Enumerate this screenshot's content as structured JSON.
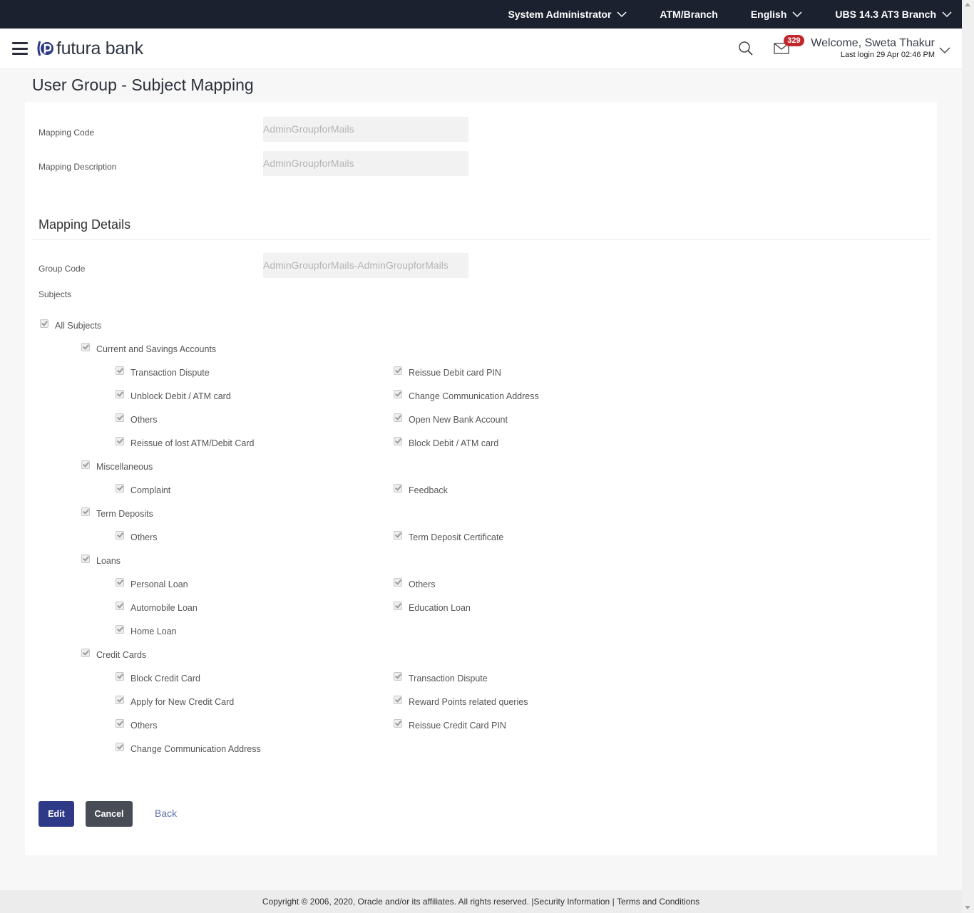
{
  "topbar": {
    "role": "System Administrator",
    "location": "ATM/Branch",
    "language": "English",
    "branch": "UBS 14.3 AT3 Branch"
  },
  "header": {
    "brand": "futura bank",
    "mail_count": "329",
    "welcome": "Welcome, Sweta Thakur",
    "last_login": "Last login 29 Apr 02:46 PM"
  },
  "page_title": "User Group - Subject Mapping",
  "form": {
    "mapping_code_label": "Mapping Code",
    "mapping_code_value": "AdminGroupforMails",
    "mapping_description_label": "Mapping Description",
    "mapping_description_value": "AdminGroupforMails",
    "section_title": "Mapping Details",
    "group_code_label": "Group Code",
    "group_code_value": "AdminGroupforMails-AdminGroupforMails",
    "subjects_label": "Subjects"
  },
  "subjects": {
    "all": {
      "label": "All Subjects",
      "checked": true
    },
    "categories": [
      {
        "label": "Current and Savings Accounts",
        "checked": true,
        "items": [
          {
            "label": "Transaction Dispute",
            "checked": true
          },
          {
            "label": "Reissue Debit card PIN",
            "checked": true
          },
          {
            "label": "Unblock Debit / ATM card",
            "checked": true
          },
          {
            "label": "Change Communication Address",
            "checked": true
          },
          {
            "label": "Others",
            "checked": true
          },
          {
            "label": "Open New Bank Account",
            "checked": true
          },
          {
            "label": "Reissue of lost ATM/Debit Card",
            "checked": true
          },
          {
            "label": "Block Debit / ATM card",
            "checked": true
          }
        ]
      },
      {
        "label": "Miscellaneous",
        "checked": true,
        "items": [
          {
            "label": "Complaint",
            "checked": true
          },
          {
            "label": "Feedback",
            "checked": true
          }
        ]
      },
      {
        "label": "Term Deposits",
        "checked": true,
        "items": [
          {
            "label": "Others",
            "checked": true
          },
          {
            "label": "Term Deposit Certificate",
            "checked": true
          }
        ]
      },
      {
        "label": "Loans",
        "checked": true,
        "items": [
          {
            "label": "Personal Loan",
            "checked": true
          },
          {
            "label": "Others",
            "checked": true
          },
          {
            "label": "Automobile Loan",
            "checked": true
          },
          {
            "label": "Education Loan",
            "checked": true
          },
          {
            "label": "Home Loan",
            "checked": true
          }
        ]
      },
      {
        "label": "Credit Cards",
        "checked": true,
        "items": [
          {
            "label": "Block Credit Card",
            "checked": true
          },
          {
            "label": "Transaction Dispute",
            "checked": true
          },
          {
            "label": "Apply for New Credit Card",
            "checked": true
          },
          {
            "label": "Reward Points related queries",
            "checked": true
          },
          {
            "label": "Others",
            "checked": true
          },
          {
            "label": "Reissue Credit Card PIN",
            "checked": true
          },
          {
            "label": "Change Communication Address",
            "checked": true
          }
        ]
      }
    ]
  },
  "actions": {
    "edit": "Edit",
    "cancel": "Cancel",
    "back": "Back"
  },
  "footer": {
    "copyright": "Copyright © 2006, 2020, Oracle and/or its affiliates. All rights reserved. | ",
    "security": "Security Information",
    "sep": " | ",
    "terms": "Terms and Conditions"
  },
  "colors": {
    "topbar_bg": "#1c2130",
    "primary_button": "#2e3a87",
    "secondary_button": "#474c55",
    "badge": "#c0262c",
    "link": "#5c6fa8"
  }
}
